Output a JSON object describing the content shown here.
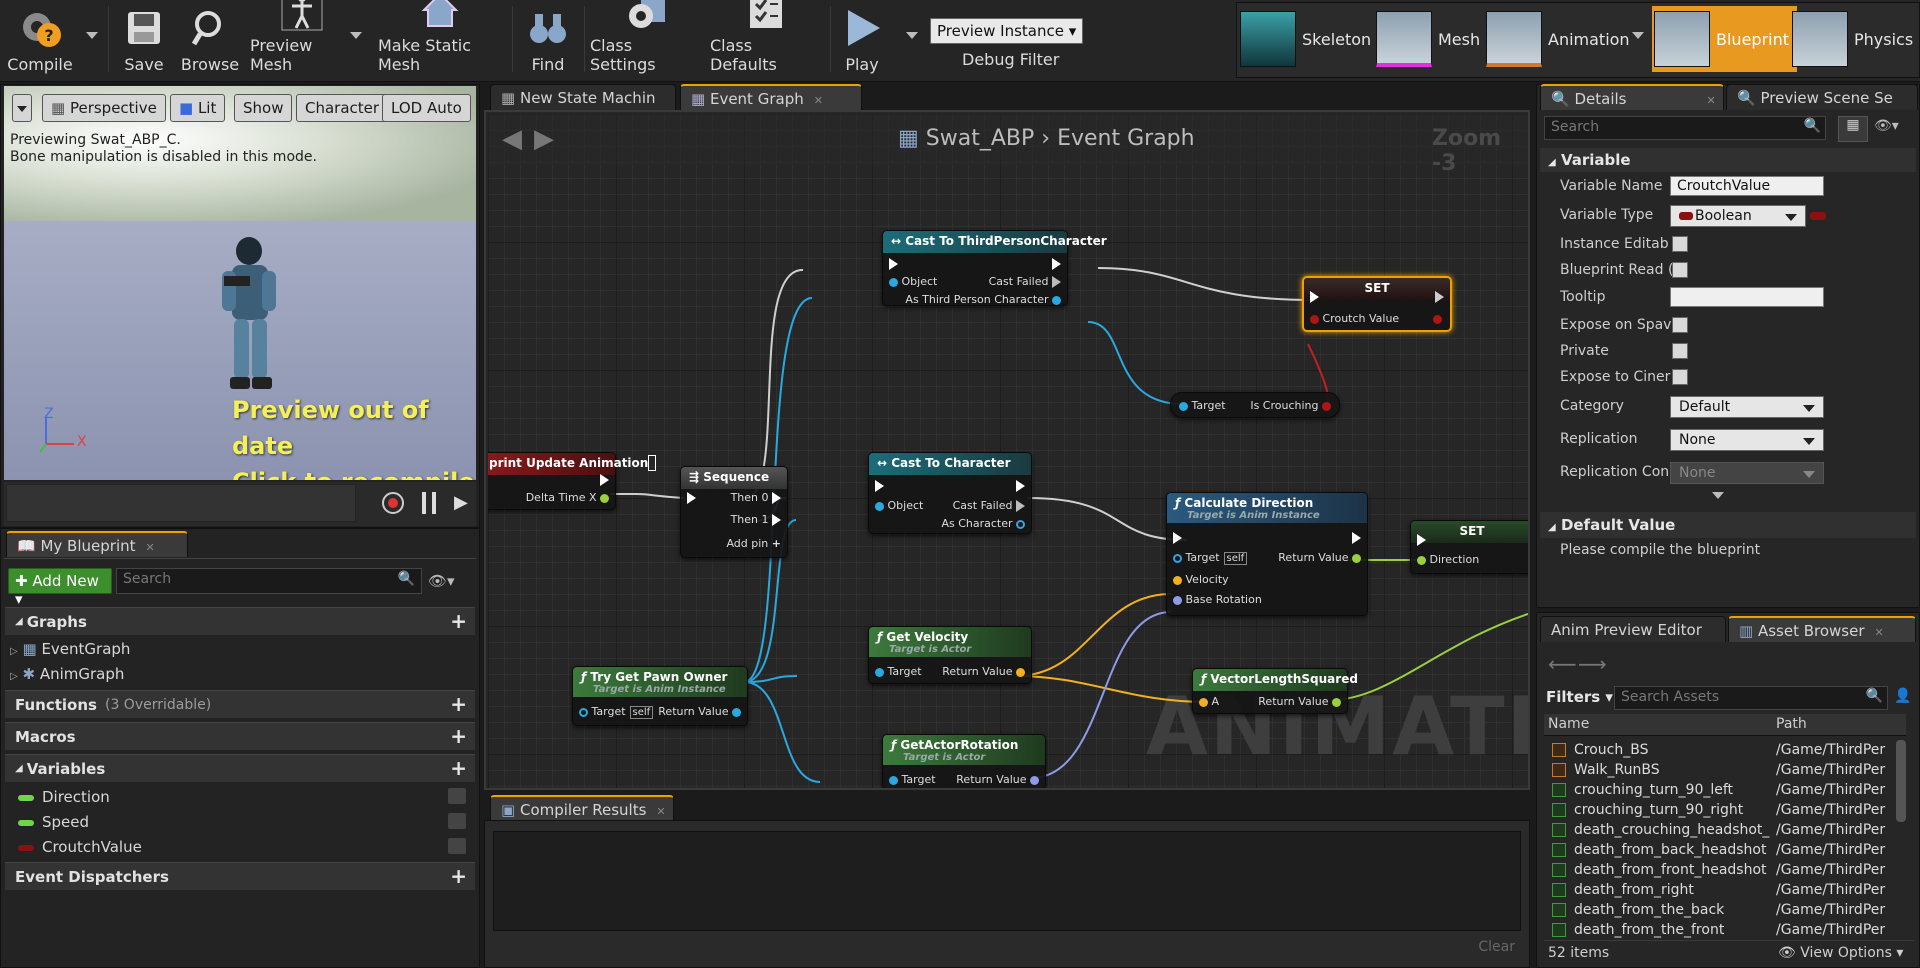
{
  "toolbar": {
    "compile": "Compile",
    "save": "Save",
    "browse": "Browse",
    "preview_mesh": "Preview Mesh",
    "make_static_mesh": "Make Static Mesh",
    "find": "Find",
    "class_settings": "Class Settings",
    "class_defaults": "Class Defaults",
    "play": "Play",
    "debug_select": "Preview Instance",
    "debug_filter": "Debug Filter"
  },
  "modes": {
    "skeleton": "Skeleton",
    "mesh": "Mesh",
    "animation": "Animation",
    "blueprint": "Blueprint",
    "physics": "Physics"
  },
  "viewport": {
    "perspective": "Perspective",
    "lit": "Lit",
    "show": "Show",
    "character": "Character",
    "lod": "LOD Auto",
    "info1": "Previewing Swat_ABP_C.",
    "info2": "Bone manipulation is disabled in this mode.",
    "warn1": "Preview out of date",
    "warn2": "Click to recompile",
    "axis_z": "Z",
    "axis_x": "X"
  },
  "my_blueprint": {
    "tab": "My Blueprint",
    "add_new": "Add New",
    "search_placeholder": "Search",
    "graphs": "Graphs",
    "graph_items": [
      "EventGraph",
      "AnimGraph"
    ],
    "functions": "Functions",
    "functions_sub": "(3 Overridable)",
    "macros": "Macros",
    "variables": "Variables",
    "vars": [
      {
        "name": "Direction",
        "color": "#6fd64a"
      },
      {
        "name": "Speed",
        "color": "#6fd64a"
      },
      {
        "name": "CroutchValue",
        "color": "#8b1010"
      }
    ],
    "event_dispatchers": "Event Dispatchers"
  },
  "graph": {
    "tab1": "New State Machin",
    "tab2": "Event Graph",
    "breadcrumb_root": "Swat_ABP",
    "breadcrumb_leaf": "Event Graph",
    "zoom": "Zoom -3",
    "watermark": "ANIMATION",
    "nodes": {
      "cast_tpc": {
        "title": "Cast To ThirdPersonCharacter",
        "object": "Object",
        "failed": "Cast Failed",
        "out": "As Third Person Character"
      },
      "set1": {
        "title": "SET",
        "pin": "Croutch Value"
      },
      "is_crouching": {
        "target": "Target",
        "out": "Is Crouching"
      },
      "update_anim": {
        "title": "print Update Animation",
        "pin": "Delta Time X"
      },
      "sequence": {
        "title": "Sequence",
        "then0": "Then 0",
        "then1": "Then 1",
        "add": "Add pin"
      },
      "cast_char": {
        "title": "Cast To Character",
        "object": "Object",
        "failed": "Cast Failed",
        "out": "As Character"
      },
      "calc_dir": {
        "title": "Calculate Direction",
        "sub": "Target is Anim Instance",
        "target": "Target",
        "self": "self",
        "ret": "Return Value",
        "velocity": "Velocity",
        "base": "Base Rotation"
      },
      "set2": {
        "title": "SET",
        "pin": "Direction"
      },
      "get_vel": {
        "title": "Get Velocity",
        "sub": "Target is Actor",
        "target": "Target",
        "ret": "Return Value"
      },
      "pawn_owner": {
        "title": "Try Get Pawn Owner",
        "sub": "Target is Anim Instance",
        "target": "Target",
        "self": "self",
        "ret": "Return Value"
      },
      "vec_len": {
        "title": "VectorLengthSquared",
        "a": "A",
        "ret": "Return Value"
      },
      "get_rot": {
        "title": "GetActorRotation",
        "sub": "Target is Actor",
        "target": "Target",
        "ret": "Return Value"
      }
    }
  },
  "compiler": {
    "tab": "Compiler Results",
    "clear": "Clear"
  },
  "details": {
    "tab": "Details",
    "tab2": "Preview Scene Se",
    "search_placeholder": "Search",
    "section": "Variable",
    "rows": {
      "name_label": "Variable Name",
      "name_value": "CroutchValue",
      "type_label": "Variable Type",
      "type_value": "Boolean",
      "instance": "Instance Editab",
      "readonly": "Blueprint Read (",
      "tooltip": "Tooltip",
      "expose_spawn": "Expose on Spav",
      "private": "Private",
      "expose_cine": "Expose to Ciner",
      "category_label": "Category",
      "category_value": "Default",
      "replication_label": "Replication",
      "replication_value": "None",
      "repcon_label": "Replication Con",
      "repcon_value": "None"
    },
    "default_section": "Default Value",
    "default_msg": "Please compile the blueprint"
  },
  "assets": {
    "tab1": "Anim Preview Editor",
    "tab2": "Asset Browser",
    "filters": "Filters",
    "search_placeholder": "Search Assets",
    "col_name": "Name",
    "col_path": "Path",
    "items": [
      {
        "name": "Crouch_BS",
        "path": "/Game/ThirdPer",
        "kind": "bs"
      },
      {
        "name": "Walk_RunBS",
        "path": "/Game/ThirdPer",
        "kind": "bs"
      },
      {
        "name": "crouching_turn_90_left",
        "path": "/Game/ThirdPer",
        "kind": "anim"
      },
      {
        "name": "crouching_turn_90_right",
        "path": "/Game/ThirdPer",
        "kind": "anim"
      },
      {
        "name": "death_crouching_headshot_",
        "path": "/Game/ThirdPer",
        "kind": "anim"
      },
      {
        "name": "death_from_back_headshot",
        "path": "/Game/ThirdPer",
        "kind": "anim"
      },
      {
        "name": "death_from_front_headshot",
        "path": "/Game/ThirdPer",
        "kind": "anim"
      },
      {
        "name": "death_from_right",
        "path": "/Game/ThirdPer",
        "kind": "anim"
      },
      {
        "name": "death_from_the_back",
        "path": "/Game/ThirdPer",
        "kind": "anim"
      },
      {
        "name": "death_from_the_front",
        "path": "/Game/ThirdPer",
        "kind": "anim"
      }
    ],
    "count": "52 items",
    "view_options": "View Options"
  }
}
